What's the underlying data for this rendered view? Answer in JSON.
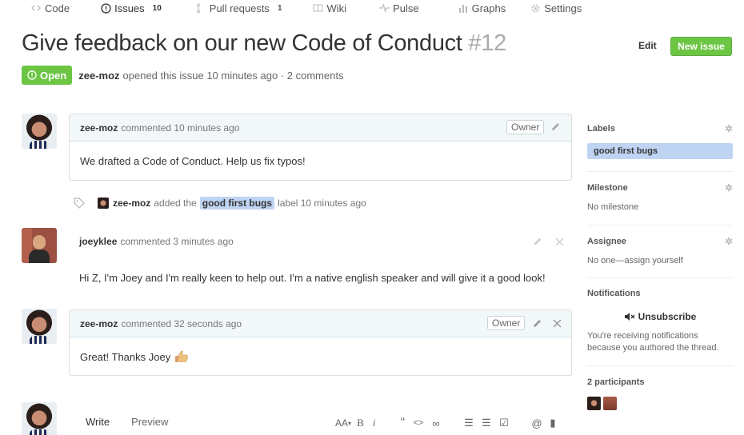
{
  "repo_nav": {
    "code": "Code",
    "issues": "Issues",
    "issues_count": "10",
    "pulls": "Pull requests",
    "pulls_count": "1",
    "wiki": "Wiki",
    "pulse": "Pulse",
    "graphs": "Graphs",
    "settings": "Settings"
  },
  "issue": {
    "title": "Give feedback on our new Code of Conduct",
    "number": "#12",
    "edit_label": "Edit",
    "new_issue_label": "New issue",
    "state": "Open",
    "author": "zee-moz",
    "meta": "opened this issue 10 minutes ago · 2 comments"
  },
  "comments": [
    {
      "author": "zee-moz",
      "when": "commented 10 minutes ago",
      "badge": "Owner",
      "body": "We drafted a Code of Conduct. Help us fix typos!"
    },
    {
      "author": "joeyklee",
      "when": "commented 3 minutes ago",
      "body": "Hi Z, I'm Joey and I'm really keen to help out. I'm a native english speaker and will give it a good look!"
    },
    {
      "author": "zee-moz",
      "when": "commented 32 seconds ago",
      "badge": "Owner",
      "body": "Great! Thanks Joey"
    }
  ],
  "label_event": {
    "author": "zee-moz",
    "pre": "added the",
    "label": "good first bugs",
    "post": "label 10 minutes ago"
  },
  "sidebar": {
    "labels_heading": "Labels",
    "label": "good first bugs",
    "milestone_heading": "Milestone",
    "milestone_value": "No milestone",
    "assignee_heading": "Assignee",
    "assignee_value": "No one—assign yourself",
    "notifications_heading": "Notifications",
    "unsubscribe": "Unsubscribe",
    "notif_note_1": "You're receiving notifications",
    "notif_note_2": "because you authored the thread.",
    "participants_heading": "2 participants"
  },
  "editor": {
    "write_tab": "Write",
    "preview_tab": "Preview",
    "toolbar": {
      "text_size": "AA",
      "bold": "B",
      "italic": "i",
      "quote": "“",
      "code": "<>",
      "link": "∞",
      "ulist": "☰",
      "olist": "☰",
      "tasklist": "☑",
      "mention": "@",
      "saved_reply": "▮"
    }
  },
  "colors": {
    "green": "#6cc644",
    "label_blue": "#bfd4f2",
    "comment_header": "#f2f8fa"
  },
  "icons": [
    "code-icon",
    "issue-icon",
    "pull-request-icon",
    "wiki-icon",
    "pulse-icon",
    "graphs-icon",
    "settings-icon",
    "pencil-icon",
    "close-icon",
    "tag-icon",
    "gear-icon",
    "mute-icon",
    "thumbs-up-icon"
  ]
}
